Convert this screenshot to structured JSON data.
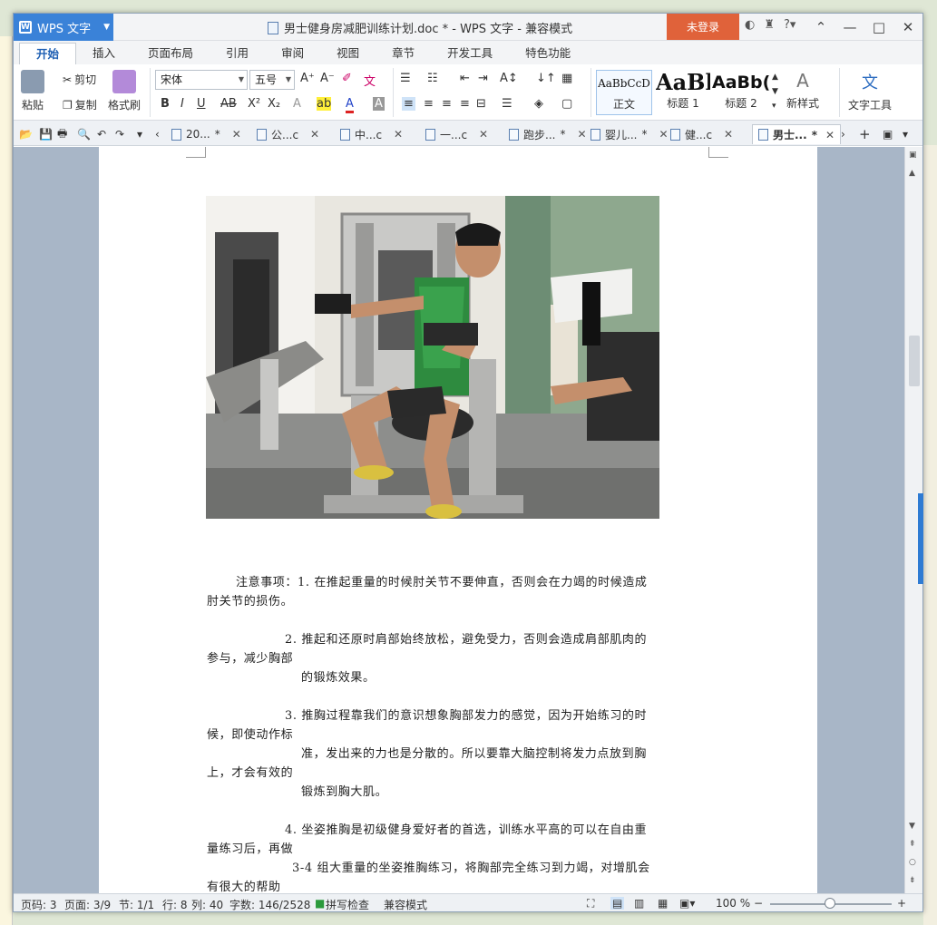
{
  "app": {
    "name": "WPS 文字",
    "title": "男士健身房减肥训练计划.doc * - WPS 文字 - 兼容模式",
    "login_label": "未登录"
  },
  "ribbon_tabs": [
    "开始",
    "插入",
    "页面布局",
    "引用",
    "审阅",
    "视图",
    "章节",
    "开发工具",
    "特色功能"
  ],
  "toolbar": {
    "paste": "粘贴",
    "cut": "剪切",
    "copy": "复制",
    "format_painter": "格式刷",
    "font_name": "宋体",
    "font_size": "五号",
    "styles": [
      {
        "preview": "AaBbCcD",
        "label": "正文"
      },
      {
        "preview": "AaBl",
        "label": "标题 1"
      },
      {
        "preview": "AaBb(",
        "label": "标题 2"
      }
    ],
    "new_style": "新样式",
    "text_tools": "文字工具"
  },
  "doc_tabs": [
    {
      "label": "20...",
      "modified": " *"
    },
    {
      "label": "公...c",
      "modified": ""
    },
    {
      "label": "中...c",
      "modified": ""
    },
    {
      "label": "一...c",
      "modified": ""
    },
    {
      "label": "跑步...",
      "modified": " *"
    },
    {
      "label": "婴儿...",
      "modified": " *"
    },
    {
      "label": "健...c",
      "modified": ""
    },
    {
      "label": "男士...",
      "modified": " *"
    }
  ],
  "document": {
    "p1_line1": "注意事项：1. 在推起重量的时候肘关节不要伸直，否则会在力竭的时候造成",
    "p1_line2": "肘关节的损伤。",
    "p2_line1": "2. 推起和还原时肩部始终放松，避免受力，否则会造成肩部肌肉的",
    "p2_line2": "参与，减少胸部",
    "p2_line3": "的锻炼效果。",
    "p3_line1": "3. 推胸过程靠我们的意识想象胸部发力的感觉，因为开始练习的时",
    "p3_line2": "候，即使动作标",
    "p3_line3": "准，发出来的力也是分散的。所以要靠大脑控制将发力点放到胸",
    "p3_line4": "上，才会有效的",
    "p3_line5": "锻炼到胸大肌。",
    "p4_line1": "4. 坐姿推胸是初级健身爱好者的首选，训练水平高的可以在自由重",
    "p4_line2": "量练习后，再做",
    "p4_line3": "3-4 组大重量的坐姿推胸练习，将胸部完全练习到力竭，对增肌会",
    "p4_line4": "有很大的帮助"
  },
  "status": {
    "page_code": "页码: 3",
    "page": "页面: 3/9",
    "section": "节: 1/1",
    "line": "行: 8",
    "column": "列: 40",
    "words": "字数: 146/2528",
    "spellcheck": "拼写检查",
    "compat": "兼容模式",
    "zoom": "100 %"
  },
  "colors": {
    "accent": "#3a82d8",
    "login": "#e0623a"
  }
}
